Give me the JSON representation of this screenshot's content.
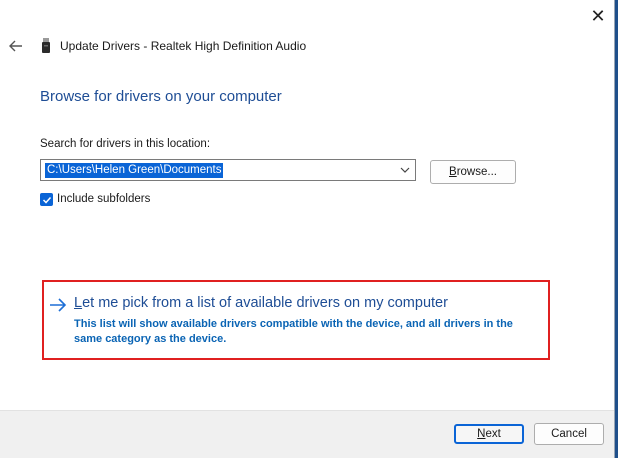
{
  "window": {
    "title": "Update Drivers - Realtek High Definition Audio",
    "close_icon": "close-icon",
    "back_icon": "back-arrow-icon",
    "device_icon": "usb-device-icon"
  },
  "content": {
    "heading": "Browse for drivers on your computer",
    "search_label": "Search for drivers in this location:",
    "path_value": "C:\\Users\\Helen Green\\Documents",
    "browse_prefix": "B",
    "browse_rest": "rowse...",
    "include_subfolders_label": "Include subfolders",
    "include_subfolders_checked": true
  },
  "pick_option": {
    "title_prefix": "L",
    "title_rest": "et me pick from a list of available drivers on my computer",
    "description": "This list will show available drivers compatible with the device, and all drivers in the same category as the device."
  },
  "footer": {
    "next_prefix": "N",
    "next_rest": "ext",
    "cancel_label": "Cancel"
  },
  "colors": {
    "heading": "#1e4d95",
    "accent": "#0a64d6",
    "highlight_border": "#e02020"
  }
}
